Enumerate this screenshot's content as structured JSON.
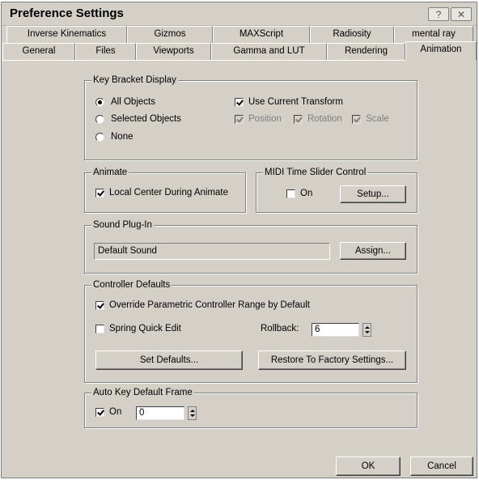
{
  "window": {
    "title": "Preference Settings",
    "help_label": "?",
    "close_label": "✕"
  },
  "tabs_row1": [
    "Inverse Kinematics",
    "Gizmos",
    "MAXScript",
    "Radiosity",
    "mental ray"
  ],
  "tabs_row2": [
    "General",
    "Files",
    "Viewports",
    "Gamma and LUT",
    "Rendering",
    "Animation"
  ],
  "active_tab": "Animation",
  "key_bracket": {
    "label": "Key Bracket Display",
    "all_objects": "All Objects",
    "selected_objects": "Selected Objects",
    "none": "None",
    "use_current_transform": "Use Current Transform",
    "position": "Position",
    "rotation": "Rotation",
    "scale": "Scale"
  },
  "animate": {
    "label": "Animate",
    "local_center": "Local Center During Animate"
  },
  "midi": {
    "label": "MIDI Time Slider Control",
    "on": "On",
    "setup": "Setup..."
  },
  "sound": {
    "label": "Sound Plug-In",
    "value": "Default Sound",
    "assign": "Assign..."
  },
  "controller": {
    "label": "Controller Defaults",
    "override": "Override Parametric Controller Range by Default",
    "spring": "Spring Quick Edit",
    "rollback_label": "Rollback:",
    "rollback_value": "6",
    "set_defaults": "Set Defaults...",
    "restore": "Restore To Factory Settings..."
  },
  "autokey": {
    "label": "Auto Key Default Frame",
    "on": "On",
    "value": "0"
  },
  "footer": {
    "ok": "OK",
    "cancel": "Cancel"
  }
}
